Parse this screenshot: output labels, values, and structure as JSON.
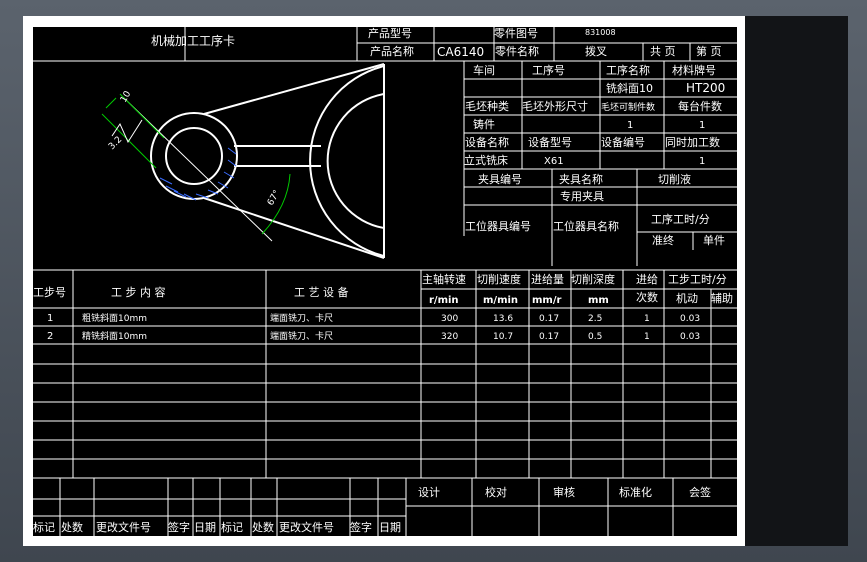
{
  "header": {
    "title": "机械加工工序卡",
    "product_model_label": "产品型号",
    "product_model_value": "",
    "part_drawing_no_label": "零件图号",
    "part_drawing_no_value": "831008",
    "product_name_label": "产品名称",
    "product_name_value": "CA6140",
    "part_name_label": "零件名称",
    "part_name_value": "拨叉",
    "total_pages_label": "共 页",
    "page_label": "第 页"
  },
  "drawing": {
    "dim_10": "10",
    "roughness": "3.2",
    "angle": "67°"
  },
  "process_info": {
    "workshop_label": "车间",
    "workshop_value": "",
    "op_no_label": "工序号",
    "op_no_value": "",
    "op_name_label": "工序名称",
    "op_name_value": "铣斜面10",
    "material_label": "材料牌号",
    "material_value": "HT200",
    "blank_type_label": "毛坯种类",
    "blank_type_value": "铸件",
    "blank_size_label": "毛坯外形尺寸",
    "blank_size_value": "",
    "parts_per_blank_label": "毛坯可制件数",
    "parts_per_blank_value": "1",
    "parts_per_unit_label": "每台件数",
    "parts_per_unit_value": "1",
    "equip_name_label": "设备名称",
    "equip_name_value": "立式铣床",
    "equip_model_label": "设备型号",
    "equip_model_value": "X61",
    "equip_no_label": "设备编号",
    "equip_no_value": "",
    "simul_label": "同时加工数",
    "simul_value": "1",
    "fixture_no_label": "夹具编号",
    "fixture_name_label": "夹具名称",
    "fixture_name_value": "专用夹具",
    "coolant_label": "切削液",
    "station_tool_no_label": "工位器具编号",
    "station_tool_name_label": "工位器具名称",
    "op_time_label": "工序工时/分",
    "prep_label": "准终",
    "unit_label": "单件"
  },
  "steps_table": {
    "headers": {
      "step_no": "工步号",
      "content": "工 步 内 容",
      "equipment": "工 艺 设 备",
      "spindle": "主轴转速",
      "speed": "切削速度",
      "feed": "进给量",
      "depth": "切削深度",
      "passes": "进给次数",
      "step_time": "工步工时/分",
      "machine": "机动",
      "aux": "辅助"
    },
    "units": {
      "spindle": "r/min",
      "speed": "m/min",
      "feed": "mm/r",
      "depth": "mm"
    },
    "rows": [
      {
        "no": "1",
        "content": "粗铣斜面10mm",
        "equipment": "端面铣刀、卡尺",
        "spindle": "300",
        "speed": "13.6",
        "feed": "0.17",
        "depth": "2.5",
        "passes": "1",
        "machine": "0.03",
        "aux": ""
      },
      {
        "no": "2",
        "content": "精铣斜面10mm",
        "equipment": "端面铣刀、卡尺",
        "spindle": "320",
        "speed": "10.7",
        "feed": "0.17",
        "depth": "0.5",
        "passes": "1",
        "machine": "0.03",
        "aux": ""
      }
    ]
  },
  "footer": {
    "design": "设计",
    "check": "校对",
    "review": "审核",
    "standard": "标准化",
    "countersign": "会签",
    "mark": "标记",
    "count": "处数",
    "change_doc": "更改文件号",
    "sign": "签字",
    "date": "日期"
  },
  "colors": {
    "background": "#000000",
    "line": "#ffffff",
    "dimension": "#00cc00",
    "hatch": "#3a6cff",
    "sheet_border": "#ffffff",
    "window": "#4d5560"
  }
}
